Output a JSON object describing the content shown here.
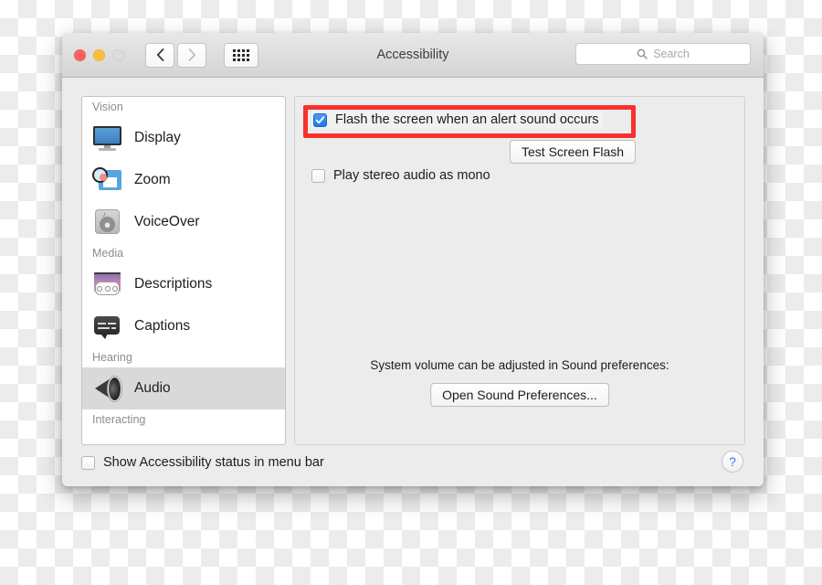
{
  "window": {
    "title": "Accessibility",
    "traffic_lights": [
      "close",
      "minimize",
      "zoom"
    ],
    "nav": {
      "back": "‹",
      "forward": "›",
      "grid": "show-all"
    },
    "search": {
      "placeholder": "Search",
      "value": ""
    }
  },
  "sidebar": {
    "groups": [
      {
        "label": "Vision",
        "items": [
          {
            "label": "Display",
            "icon": "display-icon",
            "selected": false
          },
          {
            "label": "Zoom",
            "icon": "zoom-icon",
            "selected": false
          },
          {
            "label": "VoiceOver",
            "icon": "voiceover-icon",
            "selected": false
          }
        ]
      },
      {
        "label": "Media",
        "items": [
          {
            "label": "Descriptions",
            "icon": "descriptions-icon",
            "selected": false
          },
          {
            "label": "Captions",
            "icon": "captions-icon",
            "selected": false
          }
        ]
      },
      {
        "label": "Hearing",
        "items": [
          {
            "label": "Audio",
            "icon": "audio-icon",
            "selected": true
          }
        ]
      },
      {
        "label": "Interacting",
        "items": []
      }
    ]
  },
  "content": {
    "flash_checkbox": {
      "label": "Flash the screen when an alert sound occurs",
      "checked": true
    },
    "test_button": "Test Screen Flash",
    "mono_checkbox": {
      "label": "Play stereo audio as mono",
      "checked": false
    },
    "system_volume_note": "System volume can be adjusted in Sound preferences:",
    "sound_prefs_button": "Open Sound Preferences..."
  },
  "footer": {
    "menu_bar_checkbox": {
      "label": "Show Accessibility status in menu bar",
      "checked": false
    },
    "help_button": "?"
  },
  "annotation": {
    "highlight_color": "#f9312d",
    "target": "flash-screen-checkbox-row"
  },
  "accent_color": "#1f78ec"
}
